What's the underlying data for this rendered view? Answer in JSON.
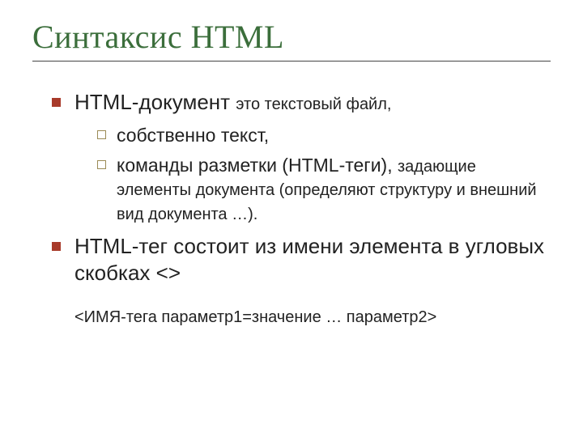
{
  "title": "Синтаксис HTML",
  "bullets": {
    "b1": {
      "lead": "HTML-документ",
      "rest": "это текстовый файл,",
      "sub": {
        "s1": "собственно текст,",
        "s2": {
          "lead": "команды разметки (HTML-теги),",
          "rest": "задающие элементы документа (определяют структуру и внешний вид документа …)."
        }
      }
    },
    "b2": {
      "line1": "HTML-тег состоит из имени элемента в угловых скобках <>",
      "tag_example": "<ИМЯ-тега параметр1=значение … параметр2>"
    }
  }
}
